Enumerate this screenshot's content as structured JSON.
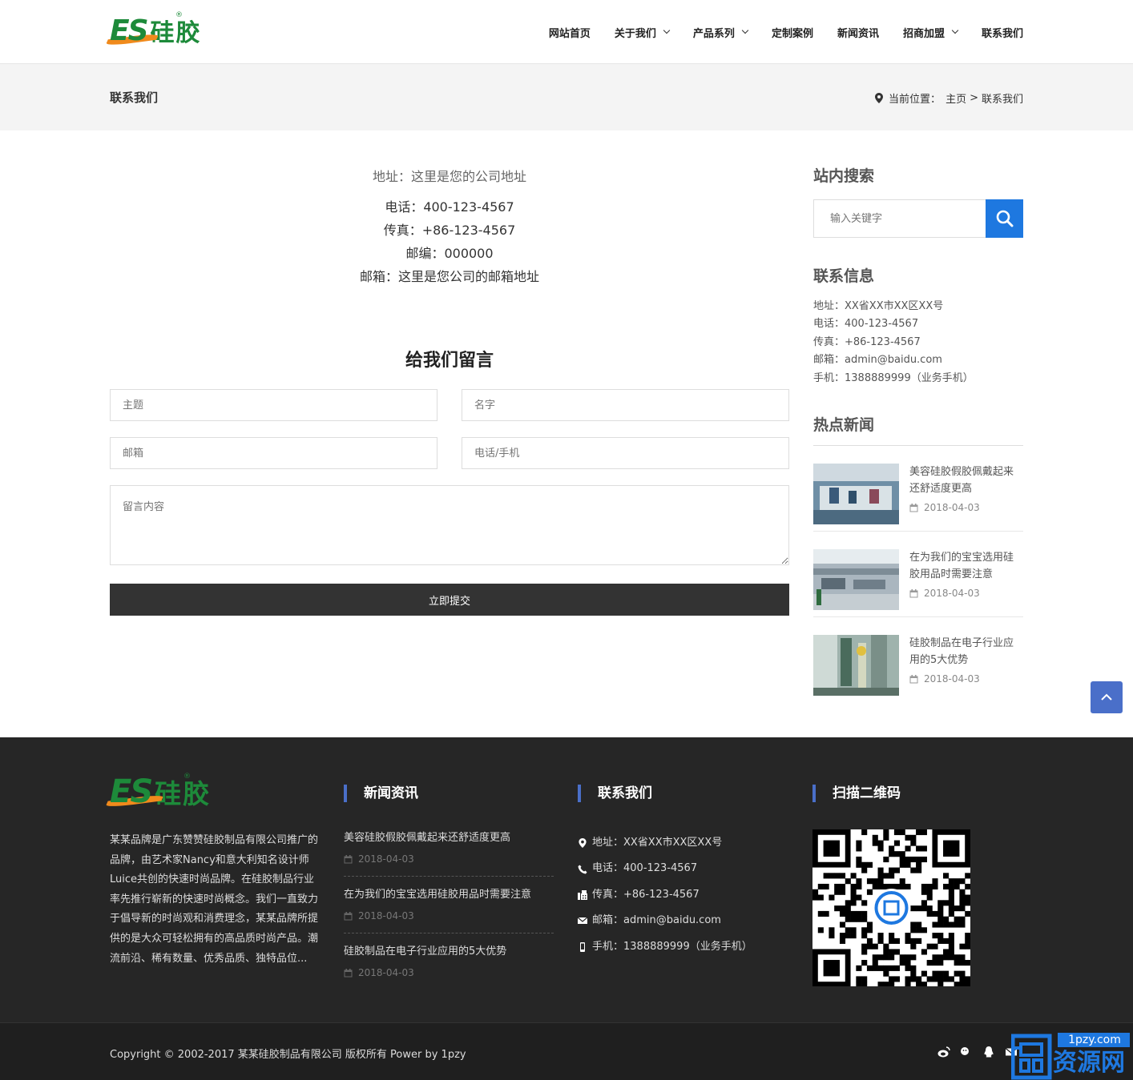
{
  "header": {
    "logo_text": "ES",
    "logo_cn": "硅胶",
    "logo_reg": "®",
    "nav": [
      {
        "label": "网站首页",
        "dropdown": false
      },
      {
        "label": "关于我们",
        "dropdown": true
      },
      {
        "label": "产品系列",
        "dropdown": true
      },
      {
        "label": "定制案例",
        "dropdown": false
      },
      {
        "label": "新闻资讯",
        "dropdown": false
      },
      {
        "label": "招商加盟",
        "dropdown": true
      },
      {
        "label": "联系我们",
        "dropdown": false
      }
    ]
  },
  "banner": {
    "title": "联系我们",
    "breadcrumb_prefix": "当前位置：",
    "breadcrumb_home": "主页",
    "breadcrumb_sep": ">",
    "breadcrumb_current": "联系我们"
  },
  "contact": {
    "address": "地址：这里是您的公司地址",
    "phone": "电话：400-123-4567",
    "fax": "传真：+86-123-4567",
    "zip": "邮编：000000",
    "email": "邮箱：这里是您公司的邮箱地址"
  },
  "form": {
    "title": "给我们留言",
    "subject_placeholder": "主题",
    "name_placeholder": "名字",
    "email_placeholder": "邮箱",
    "phone_placeholder": "电话/手机",
    "message_placeholder": "留言内容",
    "submit_label": "立即提交"
  },
  "sidebar": {
    "search_title": "站内搜索",
    "search_placeholder": "输入关键字",
    "info_title": "联系信息",
    "info": [
      "地址：XX省XX市XX区XX号",
      "电话：400-123-4567",
      "传真：+86-123-4567",
      "邮箱：admin@baidu.com",
      "手机：1388889999（业务手机）"
    ],
    "hot_title": "热点新闻",
    "hot": [
      {
        "title": "美容硅胶假胶佩戴起来还舒适度更高",
        "date": "2018-04-03"
      },
      {
        "title": "在为我们的宝宝选用硅胶用品时需要注意",
        "date": "2018-04-03"
      },
      {
        "title": "硅胶制品在电子行业应用的5大优势",
        "date": "2018-04-03"
      }
    ]
  },
  "footer": {
    "desc": "某某品牌是广东赞赞硅胶制品有限公司推广的品牌，由艺术家Nancy和意大利知名设计师Luice共创的快速时尚品牌。在硅胶制品行业率先推行崭新的快速时尚概念。我们一直致力于倡导新的时尚观和消费理念，某某品牌所提供的是大众可轻松拥有的高品质时尚产品。潮流前沿、稀有数量、优秀品质、独特品位...",
    "news_title": "新闻资讯",
    "news": [
      {
        "title": "美容硅胶假胶佩戴起来还舒适度更高",
        "date": "2018-04-03"
      },
      {
        "title": "在为我们的宝宝选用硅胶用品时需要注意",
        "date": "2018-04-03"
      },
      {
        "title": "硅胶制品在电子行业应用的5大优势",
        "date": "2018-04-03"
      }
    ],
    "contact_title": "联系我们",
    "contact": [
      {
        "icon": "map-pin-icon",
        "text": "地址：XX省XX市XX区XX号"
      },
      {
        "icon": "phone-icon",
        "text": "电话：400-123-4567"
      },
      {
        "icon": "fax-icon",
        "text": "传真：+86-123-4567"
      },
      {
        "icon": "envelope-icon",
        "text": "邮箱：admin@baidu.com"
      },
      {
        "icon": "mobile-icon",
        "text": "手机：1388889999（业务手机）"
      }
    ],
    "qr_title": "扫描二维码",
    "copyright": "Copyright © 2002-2017 某某硅胶制品有限公司 版权所有 Power by 1pzy"
  },
  "watermark": {
    "domain": "1pzy.com",
    "name": "资源网"
  },
  "colors": {
    "brand_green": "#1d8a3a",
    "brand_orange": "#f08a1c",
    "accent_blue": "#1e78e0",
    "footer_accent": "#4a6fc9",
    "footer_bg": "#262626"
  }
}
